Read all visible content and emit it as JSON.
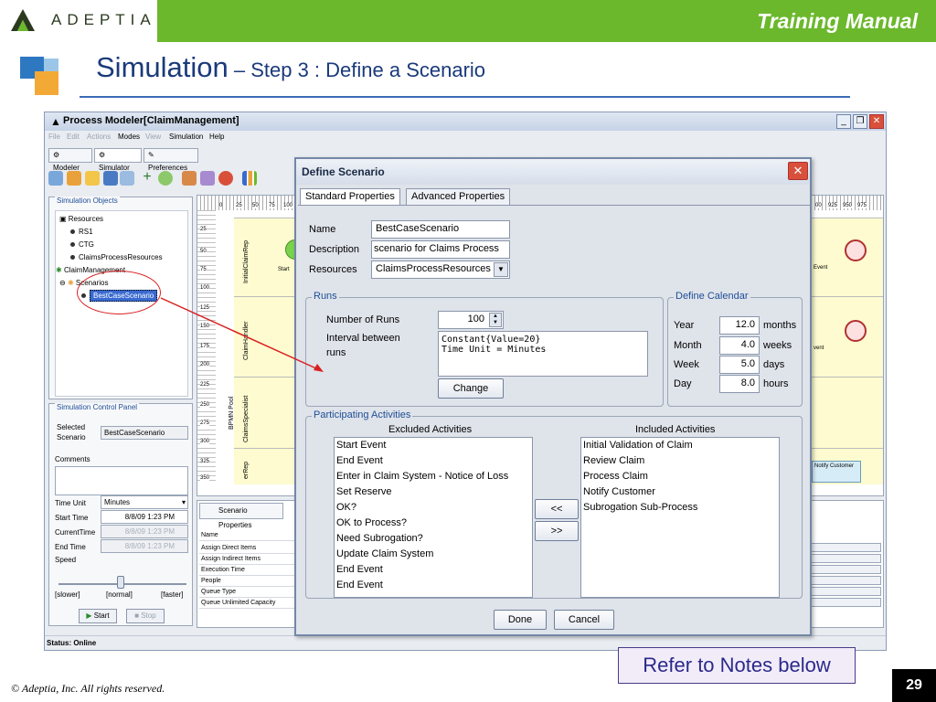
{
  "slide": {
    "logo_text": "ADEPTIA",
    "manual_title": "Training Manual",
    "title_main": "Simulation",
    "title_sub": " – Step 3 : Define a Scenario",
    "notes": "Refer to Notes below",
    "copyright": "© Adeptia, Inc.  All rights reserved.",
    "page_number": "29"
  },
  "colors": {
    "header_green": "#6bb82c",
    "title_blue": "#1a3a7a",
    "annotation_red": "#d92020"
  },
  "app": {
    "title": "Process Modeler[ClaimManagement]",
    "menu": [
      "File",
      "Edit",
      "Actions",
      "Modes",
      "View",
      "Simulation",
      "Help"
    ],
    "tabs": [
      "Modeler",
      "Simulator",
      "Preferences"
    ],
    "sim_objects": {
      "title": "Simulation Objects",
      "tree": [
        "Resources",
        "RS1",
        "CTG",
        "ClaimsProcessResources",
        "ClaimManagement",
        "Scenarios",
        "BestCaseScenario"
      ]
    },
    "control_panel": {
      "title": "Simulation Control Panel",
      "selected_label": "Selected Scenario",
      "selected_value": "BestCaseScenario",
      "comments_label": "Comments",
      "time_unit_label": "Time Unit",
      "time_unit_value": "Minutes",
      "start_time_label": "Start Time",
      "start_time_value": "8/8/09 1:23 PM",
      "current_time_label": "CurrentTime",
      "current_time_value": "8/8/09 1:23 PM",
      "end_time_label": "End Time",
      "end_time_value": "8/8/09 1:23 PM",
      "speed_label": "Speed",
      "slower": "[slower]",
      "normal": "[normal]",
      "faster": "[faster]",
      "start_button": "Start",
      "stop_button": "Stop"
    },
    "diagram": {
      "ruler_start": [
        "0",
        "25",
        "50",
        "75",
        "100"
      ],
      "ruler_end": [
        "00",
        "925",
        "950",
        "975"
      ],
      "vruler": [
        "25",
        "50",
        "75",
        "100",
        "125",
        "150",
        "175",
        "200",
        "225",
        "250",
        "275",
        "300",
        "325",
        "350"
      ],
      "lanes": [
        "InitialClaimRep",
        "ClaimHandler",
        "ClaimsSpecialist",
        "erRep"
      ],
      "pool": "BPMN Pool",
      "start_text": "Start",
      "end_text_1": "Event",
      "end_text_2": "vent",
      "notify_task": "Notify Customer"
    },
    "properties": {
      "tab": "Scenario Properties",
      "rows": [
        "Name",
        "Assign Direct Items",
        "Assign Indirect Items",
        "Execution Time",
        "People",
        "Queue Type",
        "Queue Unlimited Capacity"
      ]
    },
    "status": "Status: Online"
  },
  "dialog": {
    "title": "Define Scenario",
    "tabs": [
      "Standard Properties",
      "Advanced Properties"
    ],
    "name_label": "Name",
    "name_value": "BestCaseScenario",
    "description_label": "Description",
    "description_value": "scenario for Claims Process",
    "resources_label": "Resources",
    "resources_value": "ClaimsProcessResources",
    "runs": {
      "title": "Runs",
      "number_label": "Number of Runs",
      "number_value": "100",
      "interval_label_1": "Interval between",
      "interval_label_2": "runs",
      "interval_value_1": "Constant{Value=20}",
      "interval_value_2": "Time Unit = Minutes",
      "change_button": "Change"
    },
    "calendar": {
      "title": "Define Calendar",
      "rows": [
        {
          "label": "Year",
          "value": "12.0",
          "unit": "months"
        },
        {
          "label": "Month",
          "value": "4.0",
          "unit": "weeks"
        },
        {
          "label": "Week",
          "value": "5.0",
          "unit": "days"
        },
        {
          "label": "Day",
          "value": "8.0",
          "unit": "hours"
        }
      ]
    },
    "activities": {
      "title": "Participating Activities",
      "excluded_header": "Excluded Activities",
      "included_header": "Included Activities",
      "excluded": [
        "Start Event",
        "End Event",
        "Enter in Claim System - Notice of Loss",
        "Set Reserve",
        "OK?",
        "OK to Process?",
        "Need Subrogation?",
        "Update Claim System",
        "End Event",
        "End Event"
      ],
      "included": [
        "Initial Validation of Claim",
        "Review Claim",
        "Process Claim",
        "Notify Customer",
        "Subrogation Sub-Process"
      ],
      "move_left": "<<",
      "move_right": ">>"
    },
    "done_button": "Done",
    "cancel_button": "Cancel"
  }
}
